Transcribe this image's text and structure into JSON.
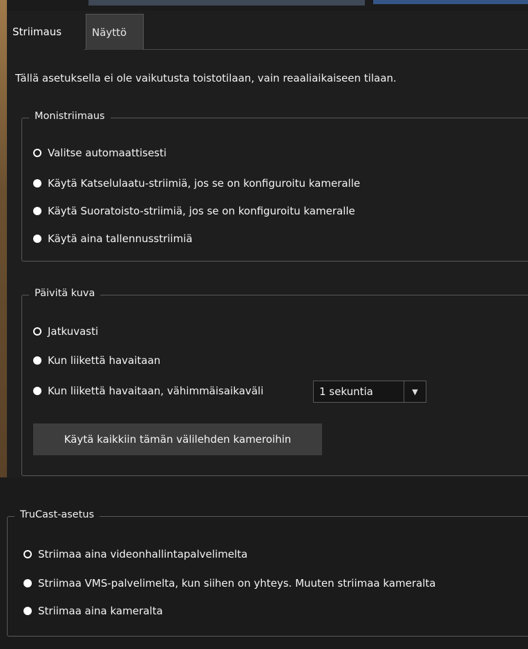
{
  "tabs": [
    {
      "label": "Striimaus",
      "active": true
    },
    {
      "label": "Näyttö",
      "active": false
    }
  ],
  "notice": "Tällä asetuksella ei ole vaikutusta toistotilaan, vain reaaliaikaiseen tilaan.",
  "multistream": {
    "legend": "Monistriimaus",
    "options": [
      {
        "label": "Valitse automaattisesti",
        "selected": true
      },
      {
        "label": "Käytä Katselulaatu-striimiä, jos se on konfiguroitu kameralle",
        "selected": false
      },
      {
        "label": "Käytä Suoratoisto-striimiä, jos se on konfiguroitu kameralle",
        "selected": false
      },
      {
        "label": "Käytä aina tallennusstriimiä",
        "selected": false
      }
    ]
  },
  "refresh": {
    "legend": "Päivitä kuva",
    "options": [
      {
        "label": "Jatkuvasti",
        "selected": true
      },
      {
        "label": "Kun liikettä havaitaan",
        "selected": false
      },
      {
        "label": "Kun liikettä havaitaan, vähimmäisaikaväli",
        "selected": false
      }
    ],
    "interval_value": "1 sekuntia",
    "apply_label": "Käytä kaikkiin tämän välilehden kameroihin"
  },
  "trucast": {
    "legend": "TruCast-asetus",
    "options": [
      {
        "label": "Striimaa aina videonhallintapalvelimelta",
        "selected": true
      },
      {
        "label": "Striimaa VMS-palvelimelta, kun siihen on yhteys. Muuten striimaa kameralta",
        "selected": false
      },
      {
        "label": "Striimaa aina kameralta",
        "selected": false
      }
    ]
  },
  "colors": {
    "background": "#1e1e1e",
    "inactive_tab": "#3a3a3a",
    "button": "#3d3d3d",
    "border": "#5a5a5a",
    "text": "#f2f2f2"
  }
}
